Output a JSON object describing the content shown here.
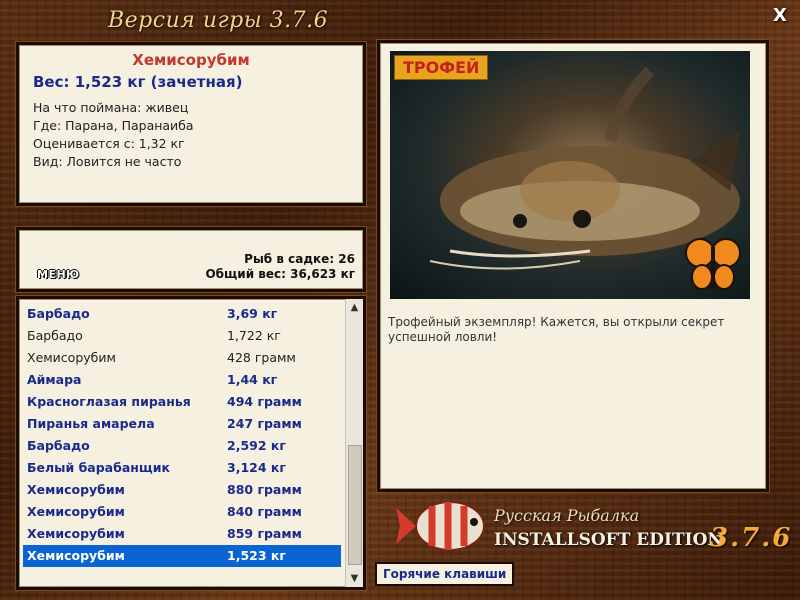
{
  "window": {
    "title": "Версия игры 3.7.6",
    "close_label": "X"
  },
  "fish_info": {
    "name": "Хемисорубим",
    "weight": "Вес: 1,523 кг (зачетная)",
    "details": [
      "На что поймана: живец",
      "Где: Парана, Паранаиба",
      "Оценивается с: 1,32 кг",
      "Вид: Ловится не часто"
    ]
  },
  "stats": {
    "menu_label": "МЕНЮ",
    "fish_count": "Рыб в садке: 26",
    "total_weight": "Общий вес: 36,623 кг"
  },
  "catch_list": [
    {
      "name": "Барбадо",
      "weight": "3,69 кг",
      "style": "b"
    },
    {
      "name": "Барбадо",
      "weight": "1,722 кг",
      "style": "p"
    },
    {
      "name": "Хемисорубим",
      "weight": "428 грамм",
      "style": "p"
    },
    {
      "name": "Аймара",
      "weight": "1,44 кг",
      "style": "b"
    },
    {
      "name": "Красноглазая пиранья",
      "weight": "494 грамм",
      "style": "b"
    },
    {
      "name": "Пиранья амарела",
      "weight": "247 грамм",
      "style": "b"
    },
    {
      "name": "Барбадо",
      "weight": "2,592 кг",
      "style": "b"
    },
    {
      "name": "Белый барабанщик",
      "weight": "3,124 кг",
      "style": "b"
    },
    {
      "name": "Хемисорубим",
      "weight": "880 грамм",
      "style": "b"
    },
    {
      "name": "Хемисорубим",
      "weight": "840 грамм",
      "style": "b"
    },
    {
      "name": "Хемисорубим",
      "weight": "859 грамм",
      "style": "b"
    },
    {
      "name": "Хемисорубим",
      "weight": "1,523 кг",
      "style": "sel"
    }
  ],
  "trophy": {
    "badge": "ТРОФЕЙ",
    "message": "Трофейный экземпляр! Кажется, вы открыли секрет успешной ловли!"
  },
  "branding": {
    "line1": "Русская Рыбалка",
    "line2": "INSTALLSOFT EDITION",
    "version": "3.7.6"
  },
  "hotkeys_label": "Горячие клавиши",
  "colors": {
    "selected": "#0a64d2",
    "bold_text": "#1a2a8c",
    "fish_name": "#c0392b"
  }
}
